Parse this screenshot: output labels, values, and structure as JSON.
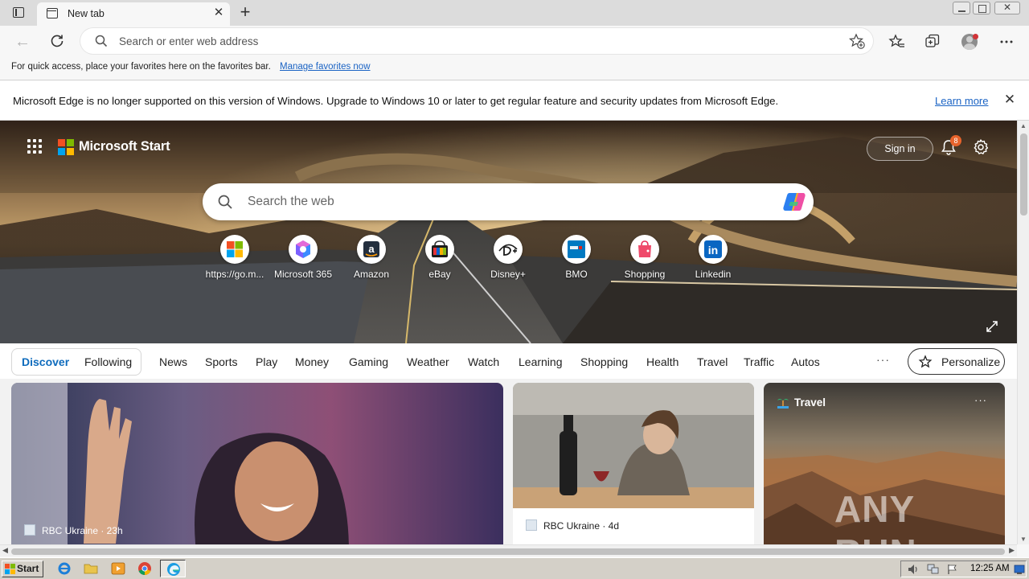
{
  "browser": {
    "tab": {
      "title": "New tab"
    },
    "address_bar": {
      "placeholder": "Search or enter web address"
    },
    "favorites_bar": {
      "text": "For quick access, place your favorites here on the favorites bar.",
      "link": "Manage favorites now"
    },
    "infobar": {
      "message": "Microsoft Edge is no longer supported on this version of Windows. Upgrade to Windows 10 or later to get regular feature and security updates from Microsoft Edge.",
      "link": "Learn more"
    }
  },
  "start": {
    "brand": "Microsoft Start",
    "signin": "Sign in",
    "notifications_count": "8",
    "search_placeholder": "Search the web",
    "quick_links": [
      {
        "label": "https://go.m...",
        "icon": "microsoft-logo-icon"
      },
      {
        "label": "Microsoft 365",
        "icon": "microsoft-365-icon"
      },
      {
        "label": "Amazon",
        "icon": "amazon-icon"
      },
      {
        "label": "eBay",
        "icon": "ebay-icon"
      },
      {
        "label": "Disney+",
        "icon": "disney-plus-icon"
      },
      {
        "label": "BMO",
        "icon": "bmo-icon"
      },
      {
        "label": "Shopping",
        "icon": "shopping-bag-icon"
      },
      {
        "label": "Linkedin",
        "icon": "linkedin-icon"
      }
    ],
    "nav": {
      "discover": "Discover",
      "following": "Following",
      "items": [
        "News",
        "Sports",
        "Play",
        "Money",
        "Gaming",
        "Weather",
        "Watch",
        "Learning",
        "Shopping",
        "Health",
        "Travel",
        "Traffic",
        "Autos"
      ],
      "more": "···",
      "personalize": "Personalize"
    },
    "cards": {
      "main": {
        "source": "RBC Ukraine · 23h"
      },
      "mid": {
        "source": "RBC Ukraine · 4d"
      },
      "travel": {
        "label": "Travel",
        "more": "···"
      }
    }
  },
  "taskbar": {
    "start": "Start",
    "clock": "12:25 AM"
  },
  "watermark": "ANY RUN",
  "colors": {
    "accent": "#0f6cbd",
    "link": "#1a63c4",
    "badge": "#e8632b"
  }
}
